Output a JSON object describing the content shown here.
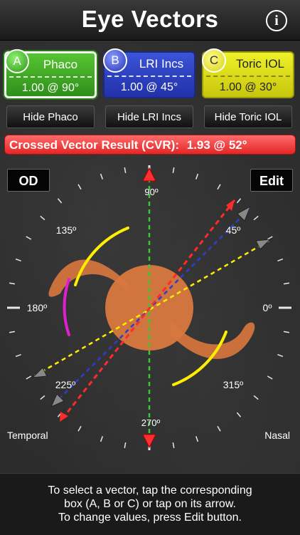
{
  "app": {
    "title": "Eye Vectors",
    "info_glyph": "i"
  },
  "vectors": [
    {
      "letter": "A",
      "name": "Phaco",
      "value": "1.00 @ 90°",
      "color": "#3fae24",
      "axis_deg": 90
    },
    {
      "letter": "B",
      "name": "LRI Incs",
      "value": "1.00 @ 45°",
      "color": "#2b3fce",
      "axis_deg": 45
    },
    {
      "letter": "C",
      "name": "Toric IOL",
      "value": "1.00 @ 30°",
      "color": "#e6e81a",
      "axis_deg": 30
    }
  ],
  "hide_buttons": [
    "Hide Phaco",
    "Hide LRI Incs",
    "Hide Toric IOL"
  ],
  "cvr": {
    "label": "Crossed Vector Result (CVR):",
    "value": "1.93 @ 52°",
    "axis_deg": 52,
    "color": "#ff2a2a"
  },
  "eye_button": "OD",
  "edit_button": "Edit",
  "dial": {
    "labels": {
      "d90": "90º",
      "d45": "45º",
      "d135": "135º",
      "d180": "180º",
      "d0": "0º",
      "d225": "225º",
      "d315": "315º",
      "d270": "270º"
    }
  },
  "sides": {
    "left": "Temporal",
    "right": "Nasal"
  },
  "instructions": [
    "To select a vector, tap the corresponding",
    "box (A, B or C) or tap on its arrow.",
    "To change values, press Edit button."
  ],
  "colors": {
    "arc_yellow": "#ffee00",
    "arc_magenta": "#e020d0",
    "lens": "#d2743e",
    "phaco_line": "#33cc33"
  }
}
